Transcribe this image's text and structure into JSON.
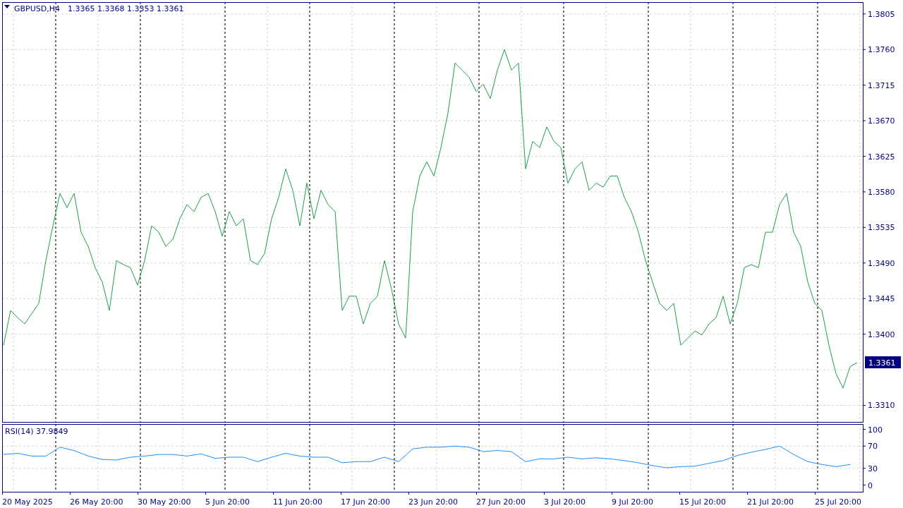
{
  "header": {
    "symbol": "GBPUSD,H4",
    "ohlc": "1.3365 1.3368 1.3353 1.3361"
  },
  "price_chart": {
    "current_price": "1.3361",
    "chart_data": {
      "type": "line",
      "grid": true,
      "ylim": [
        1.3289,
        1.382
      ],
      "yticks": [
        {
          "value": 1.331,
          "label": "1.3310"
        },
        {
          "value": 1.34,
          "label": "1.3400"
        },
        {
          "value": 1.3445,
          "label": "1.3445"
        },
        {
          "value": 1.349,
          "label": "1.3490"
        },
        {
          "value": 1.3535,
          "label": "1.3535"
        },
        {
          "value": 1.358,
          "label": "1.3580"
        },
        {
          "value": 1.3625,
          "label": "1.3625"
        },
        {
          "value": 1.367,
          "label": "1.3670"
        },
        {
          "value": 1.3715,
          "label": "1.3715"
        },
        {
          "value": 1.376,
          "label": "1.3760"
        },
        {
          "value": 1.3805,
          "label": "1.3805"
        }
      ],
      "series": [
        {
          "color": "#1e9e4a",
          "values": [
            1.3386,
            1.343,
            1.3421,
            1.3413,
            1.3426,
            1.3439,
            1.3493,
            1.3537,
            1.3578,
            1.356,
            1.3578,
            1.3529,
            1.3511,
            1.3484,
            1.3466,
            1.343,
            1.3493,
            1.3488,
            1.3484,
            1.3462,
            1.3493,
            1.3537,
            1.3529,
            1.3511,
            1.352,
            1.3546,
            1.3564,
            1.3555,
            1.3573,
            1.3578,
            1.3555,
            1.3524,
            1.3555,
            1.3537,
            1.3546,
            1.3493,
            1.3488,
            1.3502,
            1.3546,
            1.3573,
            1.3609,
            1.3582,
            1.3537,
            1.3591,
            1.3546,
            1.3582,
            1.3564,
            1.3555,
            1.343,
            1.3448,
            1.3448,
            1.3413,
            1.3439,
            1.3448,
            1.3493,
            1.3457,
            1.3413,
            1.3395,
            1.3555,
            1.36,
            1.3618,
            1.36,
            1.3636,
            1.368,
            1.3743,
            1.3734,
            1.3725,
            1.3707,
            1.3716,
            1.3698,
            1.3734,
            1.376,
            1.3734,
            1.3743,
            1.3609,
            1.3644,
            1.3636,
            1.3662,
            1.3644,
            1.3636,
            1.3591,
            1.3609,
            1.3618,
            1.3582,
            1.3591,
            1.3586,
            1.36,
            1.36,
            1.3573,
            1.3555,
            1.3529,
            1.3493,
            1.3466,
            1.3439,
            1.343,
            1.3439,
            1.3386,
            1.3395,
            1.3404,
            1.3399,
            1.3413,
            1.3421,
            1.3448,
            1.3413,
            1.3439,
            1.3484,
            1.3488,
            1.3484,
            1.3529,
            1.3529,
            1.3564,
            1.3578,
            1.3529,
            1.3511,
            1.3466,
            1.3439,
            1.343,
            1.3386,
            1.335,
            1.3332,
            1.3359,
            1.3364
          ]
        }
      ]
    }
  },
  "rsi_chart": {
    "label": "RSI(14) 37.9849",
    "chart_data": {
      "type": "line",
      "grid": true,
      "ylim": [
        -12,
        109.5
      ],
      "yticks": [
        0,
        30,
        70,
        100
      ],
      "series": [
        {
          "color": "#1e90ff",
          "values": [
            55,
            57,
            52,
            52,
            68,
            62,
            52,
            46,
            45,
            50,
            52,
            55,
            55,
            52,
            56,
            48,
            50,
            50,
            42,
            50,
            57,
            52,
            50,
            50,
            40,
            42,
            42,
            50,
            42,
            65,
            68,
            68,
            70,
            68,
            60,
            62,
            60,
            42,
            47,
            47,
            50,
            47,
            49,
            47,
            44,
            40,
            35,
            31,
            33,
            34,
            39,
            44,
            53,
            59,
            64,
            70,
            55,
            42,
            37,
            33,
            37
          ]
        }
      ]
    }
  },
  "time_axis": [
    "20 May 2025",
    "26 May 20:00",
    "30 May 20:00",
    "5 Jun 20:00",
    "11 Jun 20:00",
    "17 Jun 20:00",
    "23 Jun 20:00",
    "27 Jun 20:00",
    "3 Jul 20:00",
    "9 Jul 20:00",
    "15 Jul 20:00",
    "21 Jul 20:00",
    "25 Jul 20:00"
  ]
}
